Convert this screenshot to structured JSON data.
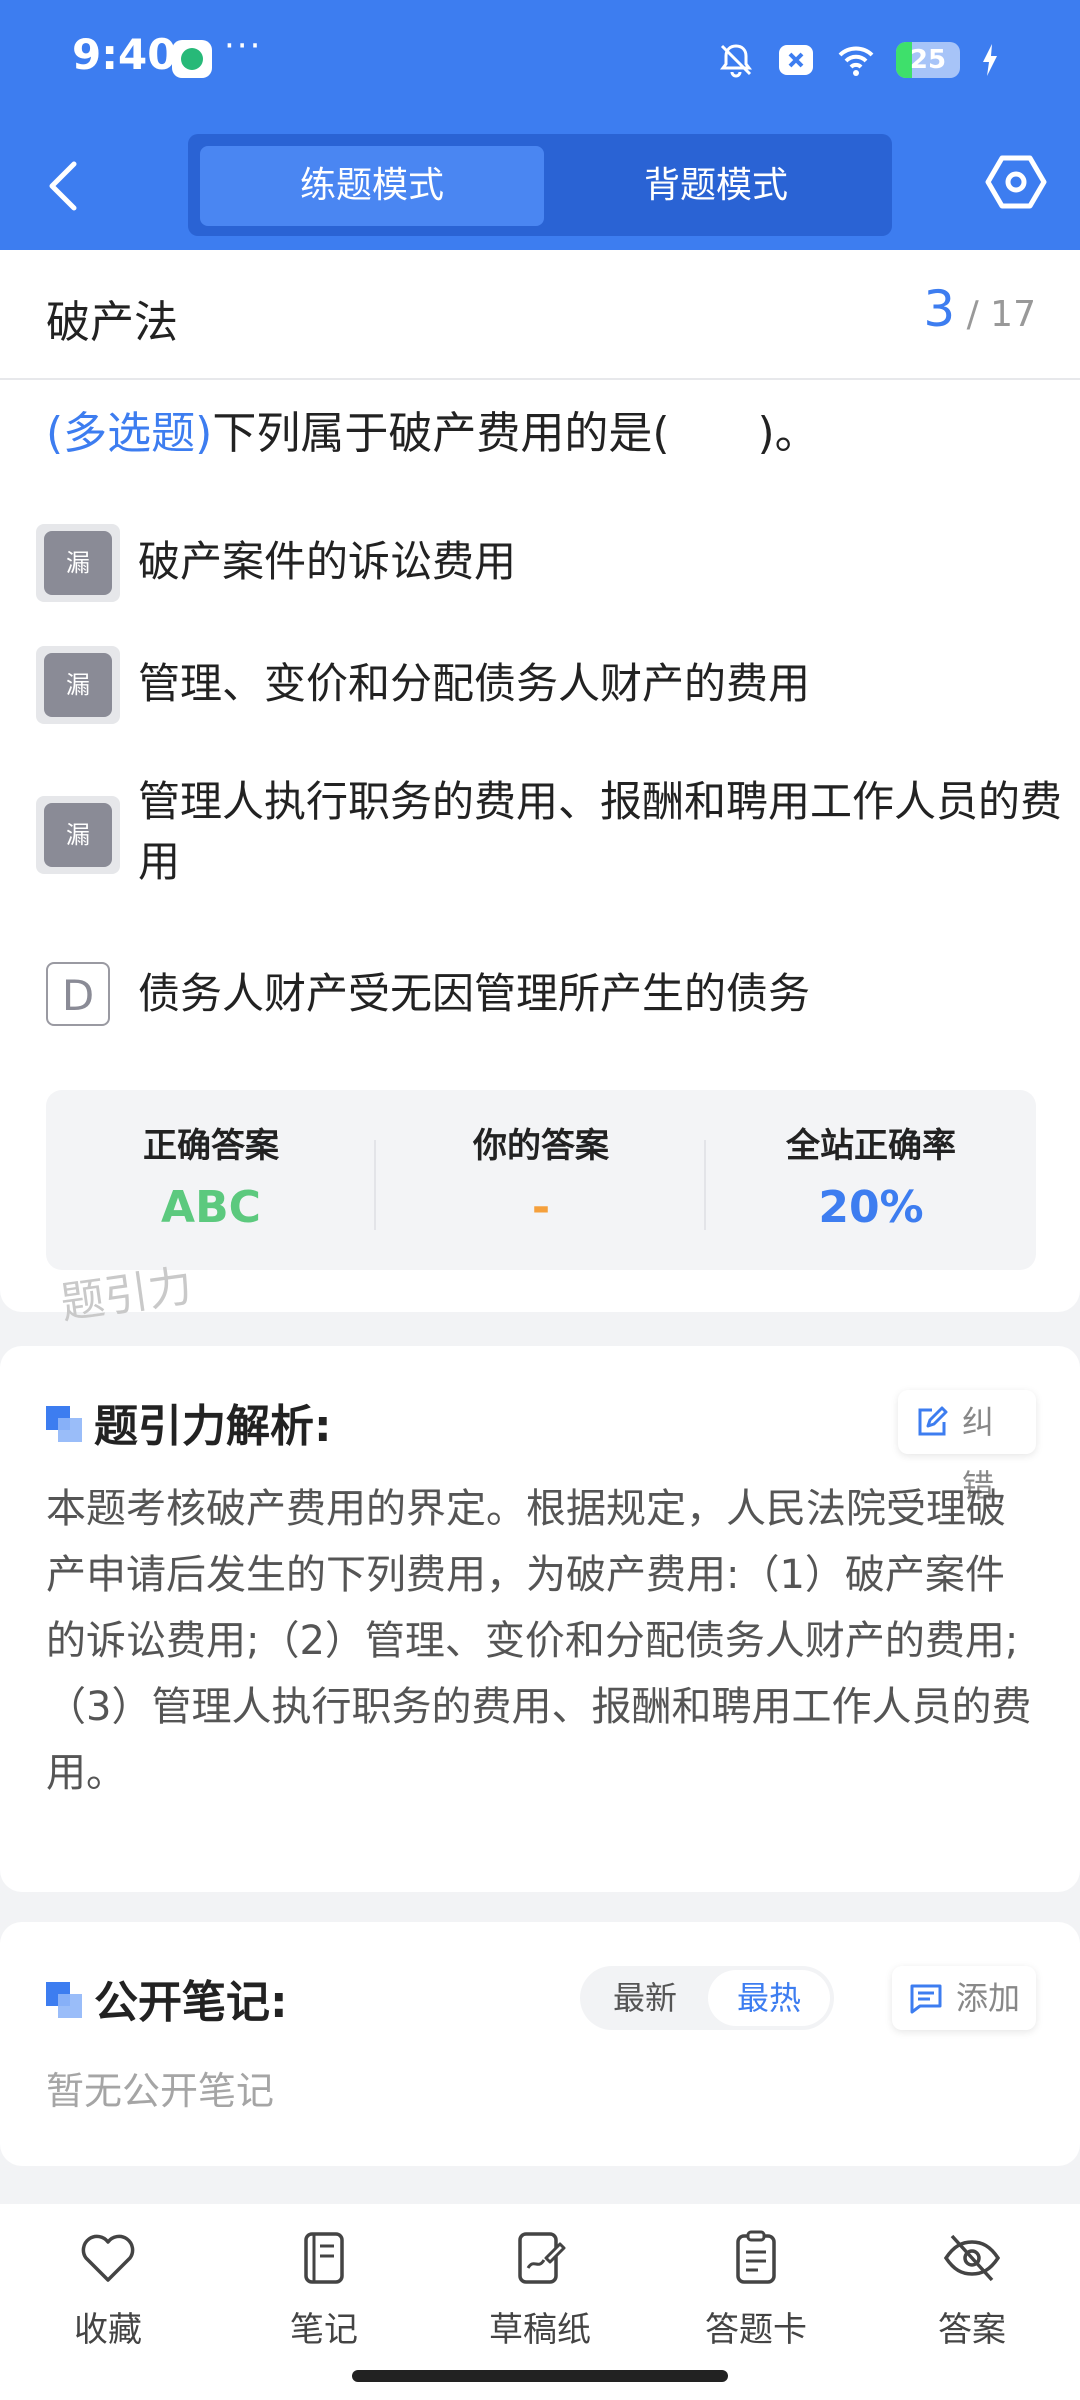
{
  "status_bar": {
    "time": "9:40",
    "dots": "···",
    "battery": "25",
    "battery_level_percent": 25,
    "icons": [
      "app-icon",
      "bell-muted-icon",
      "close-box-icon",
      "wifi-icon",
      "battery-icon",
      "charging-icon"
    ]
  },
  "header": {
    "modes": [
      "练题模式",
      "背题模式"
    ],
    "active_mode": "练题模式",
    "icons": [
      "chevron-left-icon",
      "settings-icon"
    ]
  },
  "question": {
    "chapter": "破产法",
    "current": "3",
    "total": "/ 17",
    "type": "(多选题)",
    "text": "下列属于破产费用的是(　　)。",
    "options": [
      {
        "badge": "漏",
        "text": "破产案件的诉讼费用"
      },
      {
        "badge": "漏",
        "text": "管理、变价和分配债务人财产的费用"
      },
      {
        "badge": "漏",
        "text": "管理人执行职务的费用、报酬和聘用工作人员的费用"
      },
      {
        "badge": "D",
        "text": "债务人财产受无因管理所产生的债务"
      }
    ],
    "stats": {
      "correct_label": "正确答案",
      "correct_value": "ABC",
      "yours_label": "你的答案",
      "yours_value": "-",
      "rate_label": "全站正确率",
      "rate_value": "20%"
    },
    "watermark": "题引力"
  },
  "analysis": {
    "title": "题引力解析:",
    "report_label": "纠错",
    "text": "本题考核破产费用的界定。根据规定，人民法院受理破产申请后发生的下列费用，为破产费用:（1）破产案件的诉讼费用;（2）管理、变价和分配债务人财产的费用;（3）管理人执行职务的费用、报酬和聘用工作人员的费用。"
  },
  "notes": {
    "title": "公开笔记:",
    "sort_latest": "最新",
    "sort_hot": "最热",
    "active_sort": "最热",
    "add_label": "添加",
    "empty_text": "暂无公开笔记"
  },
  "bottom_nav": [
    {
      "label": "收藏",
      "icon": "heart-icon"
    },
    {
      "label": "笔记",
      "icon": "notebook-icon"
    },
    {
      "label": "草稿纸",
      "icon": "draft-icon"
    },
    {
      "label": "答题卡",
      "icon": "answer-sheet-icon"
    },
    {
      "label": "答案",
      "icon": "eye-off-icon"
    }
  ],
  "colors": {
    "brand_blue": "#3d7df0",
    "correct_green": "#5cc97e",
    "your_answer_orange": "#f5a03c",
    "rate_blue": "#3d7df0"
  }
}
